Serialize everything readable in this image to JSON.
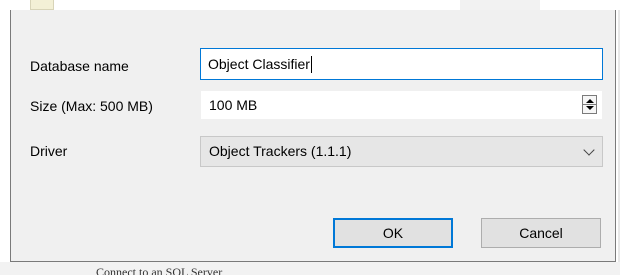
{
  "form": {
    "database_name": {
      "label": "Database name",
      "value": "Object Classifier"
    },
    "size": {
      "label": "Size (Max: 500 MB)",
      "value": "100 MB"
    },
    "driver": {
      "label": "Driver",
      "value": "Object Trackers (1.1.1)"
    }
  },
  "buttons": {
    "ok_label": "OK",
    "cancel_label": "Cancel"
  },
  "icons": {
    "spin_up": "spin-up-arrow-icon",
    "spin_down": "spin-down-arrow-icon",
    "dropdown": "chevron-down-icon"
  },
  "colors": {
    "focus_accent": "#0078d7",
    "dialog_bg": "#f0f0f0"
  },
  "background": {
    "bottom_text": "Connect to an SQL Server"
  }
}
